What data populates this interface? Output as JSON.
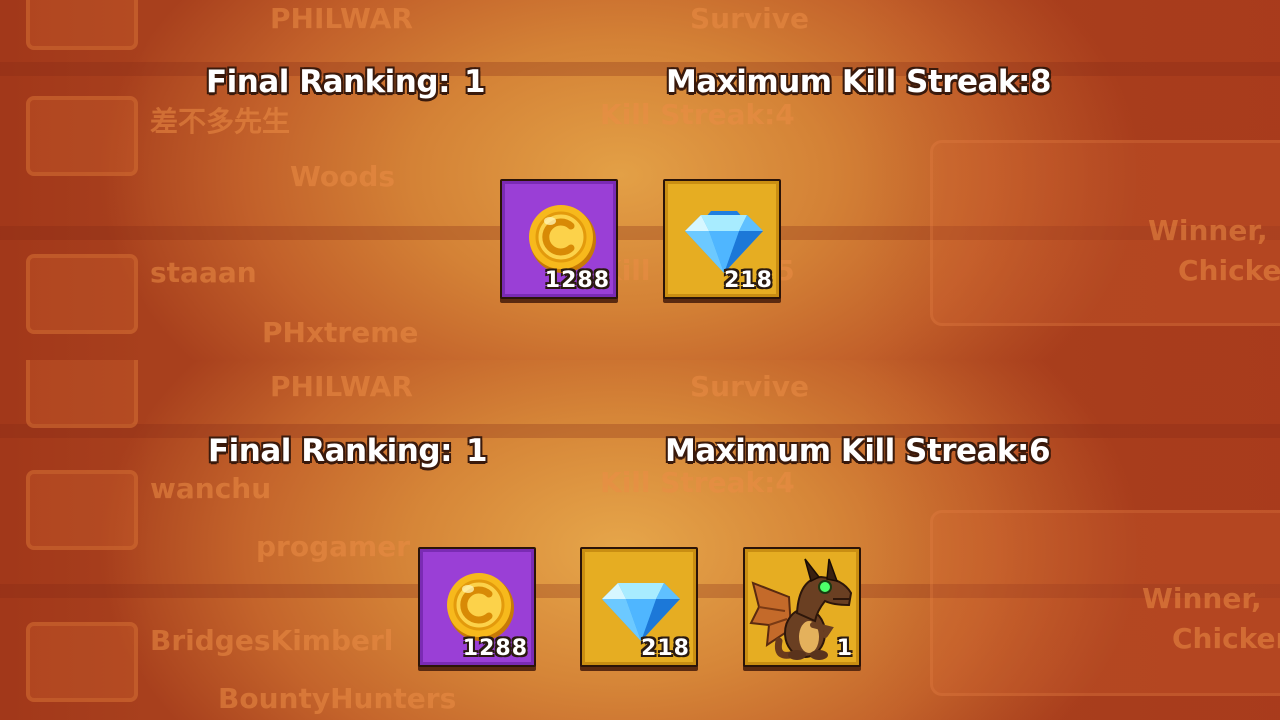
{
  "panels": [
    {
      "final_ranking_label": "Final Ranking:",
      "final_ranking_value": "1",
      "kill_streak_label": "Maximum Kill Streak:",
      "kill_streak_value": "8",
      "rewards": [
        {
          "type": "coin",
          "icon": "gold-coin-icon",
          "count": "1288",
          "bg": "#9a3fd6"
        },
        {
          "type": "diamond",
          "icon": "diamond-icon",
          "count": "218",
          "bg": "#e6ad22"
        }
      ],
      "background_list": {
        "names": [
          "PHILWAR",
          "差不多先生",
          "Woods",
          "staaan",
          "PHxtreme"
        ],
        "center_labels": [
          "Survive",
          "Kill Streak:4",
          "Kill Streak:5"
        ],
        "right_label": [
          "Winner,",
          "Chicken"
        ]
      }
    },
    {
      "final_ranking_label": "Final Ranking:",
      "final_ranking_value": "1",
      "kill_streak_label": "Maximum Kill Streak:",
      "kill_streak_value": "6",
      "rewards": [
        {
          "type": "coin",
          "icon": "gold-coin-icon",
          "count": "1288",
          "bg": "#9a3fd6"
        },
        {
          "type": "diamond",
          "icon": "diamond-icon",
          "count": "218",
          "bg": "#e6ad22"
        },
        {
          "type": "dragon",
          "icon": "dragon-icon",
          "count": "1",
          "bg": "#e6ad22"
        }
      ],
      "background_list": {
        "names": [
          "PHILWAR",
          "wanchu",
          "progamer",
          "BridgesKimberl",
          "BountyHunters"
        ],
        "center_labels": [
          "Survive",
          "Kill Streak:4"
        ],
        "right_label": [
          "Winner,",
          "Chicken"
        ]
      }
    }
  ]
}
